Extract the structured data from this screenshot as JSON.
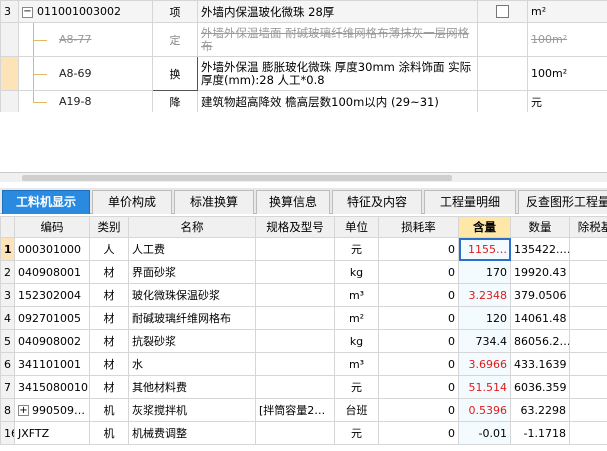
{
  "top_rows": [
    {
      "num": "3",
      "code": "011001003002",
      "type": "项",
      "name": "外墙内保温玻化微珠 28厚",
      "unit": "m²"
    },
    {
      "num": "",
      "code": "A8-77",
      "type": "定",
      "name": "外墙外保温墙面 耐碱玻璃纤维网格布薄抹灰一层网格布",
      "unit": "100m²"
    },
    {
      "num": "",
      "code": "A8-69",
      "type": "换",
      "name": "外墙外保温 膨胀玻化微珠 厚度30mm 涂料饰面  实际厚度(mm):28  人工*0.8",
      "unit": "100m²"
    },
    {
      "num": "",
      "code": "A19-8",
      "type": "降",
      "name": "建筑物超高降效 檐高层数100m以内 (29~31)",
      "unit": "元"
    }
  ],
  "tabs": [
    "工料机显示",
    "单价构成",
    "标准换算",
    "换算信息",
    "特征及内容",
    "工程量明细",
    "反查图形工程量"
  ],
  "columns": [
    "编码",
    "类别",
    "名称",
    "规格及型号",
    "单位",
    "损耗率",
    "含量",
    "数量",
    "除税基"
  ],
  "rows": [
    {
      "num": "1",
      "code": "000301000",
      "cat": "人",
      "name": "人工费",
      "spec": "",
      "unit": "元",
      "loss": "0",
      "qty": "1155…",
      "amount": "135422.…",
      "extra": ""
    },
    {
      "num": "2",
      "code": "040908001",
      "cat": "材",
      "name": "界面砂浆",
      "spec": "",
      "unit": "kg",
      "loss": "0",
      "qty": "170",
      "amount": "19920.43",
      "extra": ""
    },
    {
      "num": "3",
      "code": "152302004",
      "cat": "材",
      "name": "玻化微珠保温砂浆",
      "spec": "",
      "unit": "m³",
      "loss": "0",
      "qty": "3.2348",
      "amount": "379.0506",
      "extra": "5"
    },
    {
      "num": "4",
      "code": "092701005",
      "cat": "材",
      "name": "耐碱玻璃纤维网格布",
      "spec": "",
      "unit": "m²",
      "loss": "0",
      "qty": "120",
      "amount": "14061.48",
      "extra": ""
    },
    {
      "num": "5",
      "code": "040908002",
      "cat": "材",
      "name": "抗裂砂浆",
      "spec": "",
      "unit": "kg",
      "loss": "0",
      "qty": "734.4",
      "amount": "86056.2…",
      "extra": ""
    },
    {
      "num": "6",
      "code": "341101001",
      "cat": "材",
      "name": "水",
      "spec": "",
      "unit": "m³",
      "loss": "0",
      "qty": "3.6966",
      "amount": "433.1639",
      "extra": ""
    },
    {
      "num": "7",
      "code": "34150800101",
      "cat": "材",
      "name": "其他材料费",
      "spec": "",
      "unit": "元",
      "loss": "0",
      "qty": "51.514",
      "amount": "6036.359",
      "extra": ""
    },
    {
      "num": "8",
      "code": "990509…",
      "cat": "机",
      "name": "灰浆搅拌机",
      "spec": "[拌筒容量2…",
      "unit": "台班",
      "loss": "0",
      "qty": "0.5396",
      "amount": "63.2298",
      "extra": ""
    },
    {
      "num": "16",
      "code": "JXFTZ",
      "cat": "机",
      "name": "机械费调整",
      "spec": "",
      "unit": "元",
      "loss": "0",
      "qty": "-0.01",
      "amount": "-1.1718",
      "extra": ""
    }
  ],
  "colors": {
    "tab_active": "#2a8ae0",
    "highlight_red": "#e01b1b",
    "header_highlight": "#ffe7a8"
  }
}
